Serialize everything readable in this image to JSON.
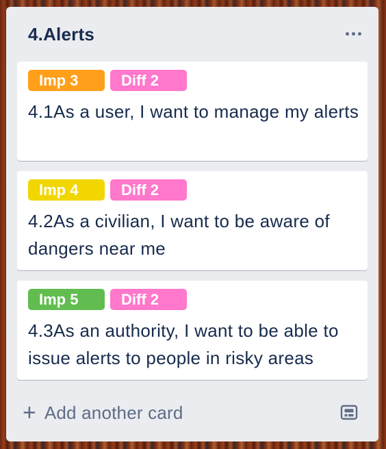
{
  "list": {
    "title": "4.Alerts",
    "menu_icon": "ellipsis-icon",
    "cards": [
      {
        "labels": [
          {
            "text": "Imp 3",
            "color": "#ff9f1a"
          },
          {
            "text": "Diff 2",
            "color": "#ff78cb"
          }
        ],
        "text": "4.1As a user, I want to manage my alerts"
      },
      {
        "labels": [
          {
            "text": "Imp 4",
            "color": "#f2d600"
          },
          {
            "text": "Diff 2",
            "color": "#ff78cb"
          }
        ],
        "text": "4.2As a civilian, I want to be aware of dangers near me"
      },
      {
        "labels": [
          {
            "text": "Imp 5",
            "color": "#61bd4f"
          },
          {
            "text": "Diff 2",
            "color": "#ff78cb"
          }
        ],
        "text": "4.3As an authority, I want to be able to issue alerts to people in risky areas"
      }
    ],
    "add_card_label": "Add another card",
    "add_icon": "plus-icon",
    "template_icon": "card-template-icon"
  }
}
